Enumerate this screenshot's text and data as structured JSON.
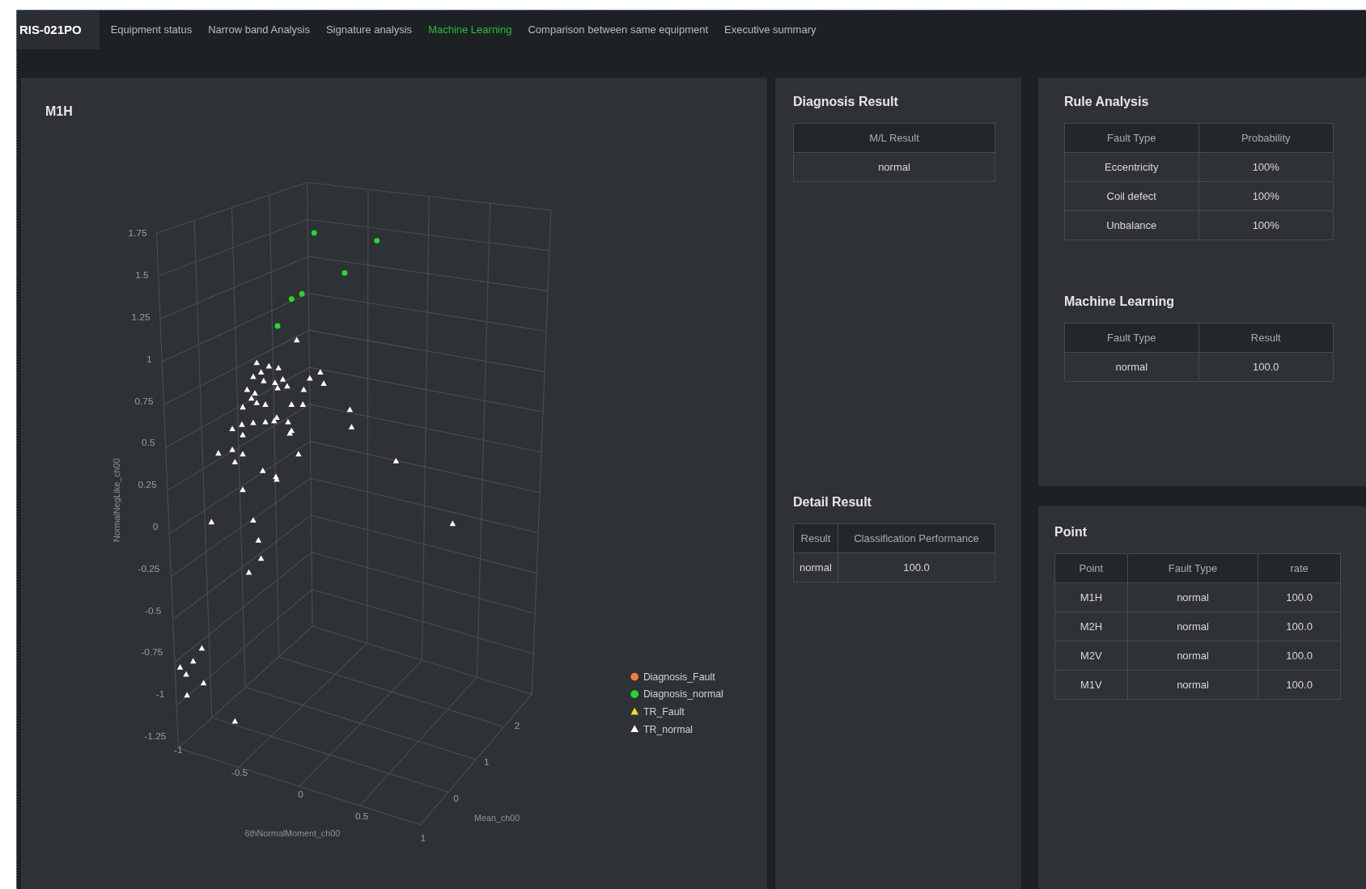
{
  "nav": {
    "brand": "RIS-021PO",
    "tabs": [
      {
        "label": "Equipment status",
        "selected": false
      },
      {
        "label": "Narrow band Analysis",
        "selected": false
      },
      {
        "label": "Signature analysis",
        "selected": false
      },
      {
        "label": "Machine Learning",
        "selected": true
      },
      {
        "label": "Comparison between same equipment",
        "selected": false
      },
      {
        "label": "Executive summary",
        "selected": false
      }
    ]
  },
  "chart_panel": {
    "title": "M1H",
    "plot": {
      "zlabel": "NormalNegLike_ch00",
      "xlabel": "6thNormalMoment_ch00",
      "ylabel": "Mean_ch00",
      "zticks": [
        "1.75",
        "1.5",
        "1.25",
        "1",
        "0.75",
        "0.5",
        "0.25",
        "0",
        "-0.25",
        "-0.5",
        "-0.75",
        "-1",
        "-1.25"
      ],
      "xticks": [
        "-1",
        "-0.5",
        "0",
        "0.5",
        "1"
      ],
      "yticks": [
        "0",
        "1",
        "2"
      ],
      "legend": [
        {
          "label": "Diagnosis_Fault",
          "color": "#f07c3e",
          "kind": "circle"
        },
        {
          "label": "Diagnosis_normal",
          "color": "#22dd22",
          "kind": "circle"
        },
        {
          "label": "TR_Fault",
          "color": "#f2e21c",
          "kind": "triangle"
        },
        {
          "label": "TR_normal",
          "color": "#ffffff",
          "kind": "triangle"
        }
      ]
    }
  },
  "diagnosis_result": {
    "title": "Diagnosis Result",
    "columns": [
      "M/L Result"
    ],
    "rows": [
      [
        "normal"
      ]
    ]
  },
  "detail_result": {
    "title": "Detail Result",
    "columns": [
      "Result",
      "Classification Performance"
    ],
    "rows": [
      [
        "normal",
        "100.0"
      ]
    ]
  },
  "rule_analysis": {
    "title": "Rule Analysis",
    "columns": [
      "Fault Type",
      "Probability"
    ],
    "rows": [
      [
        "Eccentricity",
        "100%"
      ],
      [
        "Coil defect",
        "100%"
      ],
      [
        "Unbalance",
        "100%"
      ]
    ]
  },
  "machine_learning": {
    "title": "Machine Learning",
    "columns": [
      "Fault Type",
      "Result"
    ],
    "rows": [
      [
        "normal",
        "100.0"
      ]
    ]
  },
  "point": {
    "title": "Point",
    "columns": [
      "Point",
      "Fault Type",
      "rate"
    ],
    "rows": [
      [
        "M1H",
        "normal",
        "100.0"
      ],
      [
        "M2H",
        "normal",
        "100.0"
      ],
      [
        "M2V",
        "normal",
        "100.0"
      ],
      [
        "M1V",
        "normal",
        "100.0"
      ]
    ]
  }
}
